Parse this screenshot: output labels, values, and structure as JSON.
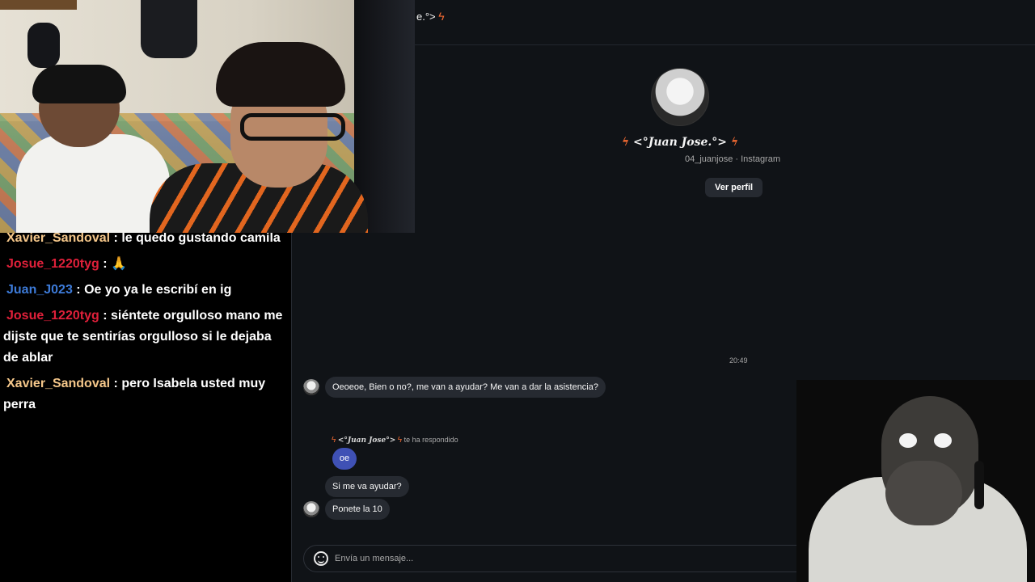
{
  "chat": {
    "messages": [
      {
        "user": "Xavier_Sandoval",
        "color": "#f5c78a",
        "text": "le quedo gustando camila"
      },
      {
        "user": "Josue_1220tyg",
        "color": "#e0203a",
        "text": "🙏"
      },
      {
        "user": "Juan_J023",
        "color": "#3d7bd9",
        "text": "Oe yo ya le escribí en ig"
      },
      {
        "user": "Josue_1220tyg",
        "color": "#e0203a",
        "text": "siéntete orgulloso mano me dijste que te sentirías orgulloso si le dejaba de ablar"
      },
      {
        "user": "Xavier_Sandoval",
        "color": "#f5c78a",
        "text": "pero Isabela usted muy perra"
      }
    ]
  },
  "ig": {
    "header_title": "e.°>",
    "profile": {
      "name": "<°Juan Jose.°>",
      "subtitle": "04_juanjose · Instagram",
      "view_profile": "Ver perfil"
    },
    "timestamp": "20:49",
    "messages": {
      "first": "Oeoeoe, Bien o no?, me van a ayudar? Me van a dar la asistencia?",
      "replied_name": "<°Juan Jose°>",
      "replied_text": "te ha respondido",
      "reply_bubble": "oe",
      "second": "Si me va ayudar?",
      "third": "Ponete la 10"
    },
    "composer_placeholder": "Envía un mensaje..."
  },
  "colors": {
    "accent_bolt": "#f26a32",
    "reply_bubble": "#3f51b5",
    "panel_bg": "#101317"
  }
}
